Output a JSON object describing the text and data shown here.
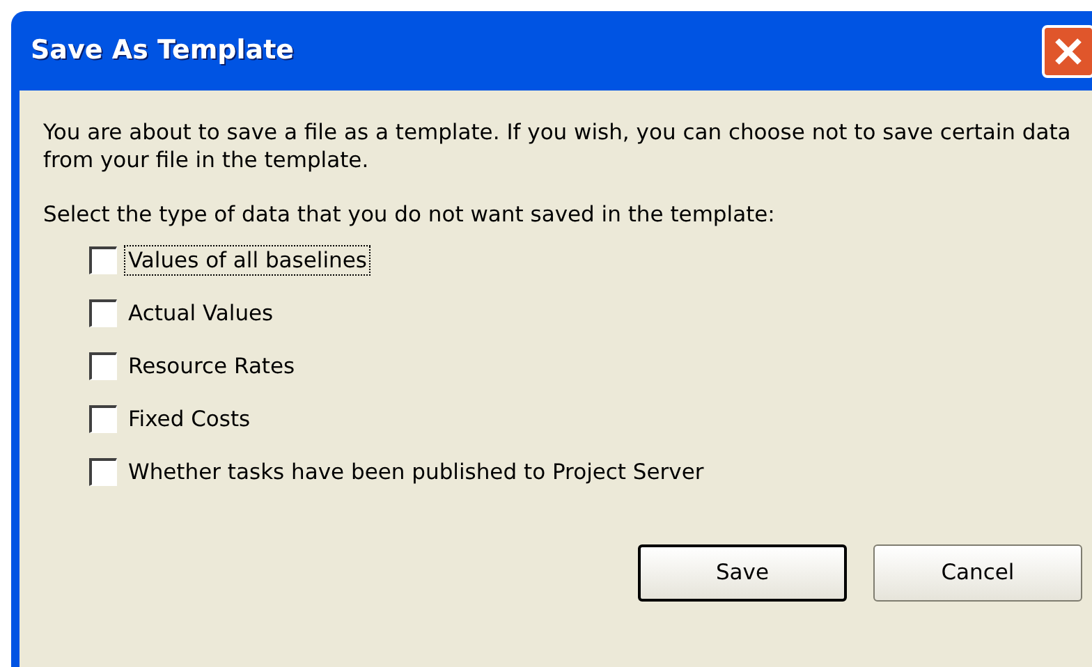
{
  "window": {
    "title": "Save As Template"
  },
  "intro": "You are about to save a file as a template.  If you wish, you can choose not to save certain data from your file in the template.",
  "prompt": "Select the type of data that you do not want saved in the template:",
  "options": [
    {
      "label": "Values of all baselines",
      "checked": false,
      "focused": true
    },
    {
      "label": "Actual Values",
      "checked": false,
      "focused": false
    },
    {
      "label": "Resource Rates",
      "checked": false,
      "focused": false
    },
    {
      "label": "Fixed Costs",
      "checked": false,
      "focused": false
    },
    {
      "label": "Whether tasks have been published to Project Server",
      "checked": false,
      "focused": false
    }
  ],
  "buttons": [
    {
      "label": "Save",
      "default": true
    },
    {
      "label": "Cancel",
      "default": false
    }
  ]
}
